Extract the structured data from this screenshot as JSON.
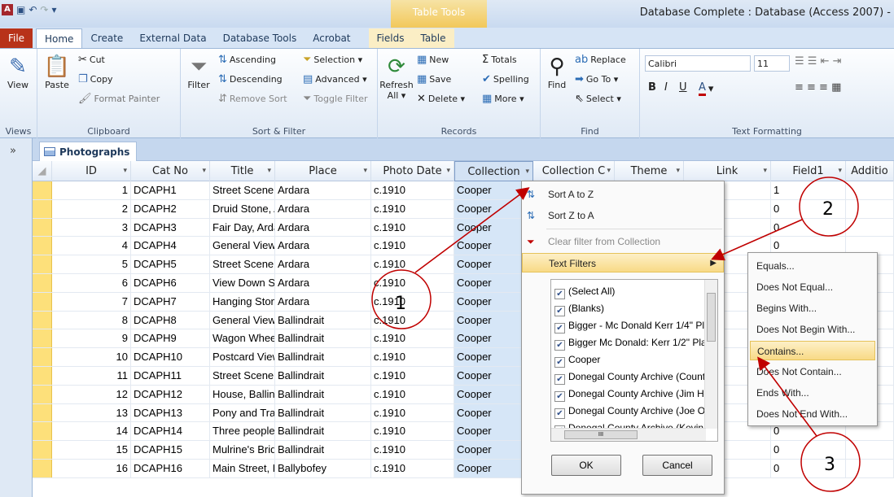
{
  "window": {
    "title": "Database Complete : Database (Access 2007) -",
    "context_tab": "Table Tools"
  },
  "tabs": [
    "File",
    "Home",
    "Create",
    "External Data",
    "Database Tools",
    "Acrobat",
    "Fields",
    "Table"
  ],
  "ribbon": {
    "views": {
      "view": "View",
      "label": "Views"
    },
    "clipboard": {
      "paste": "Paste",
      "cut": "Cut",
      "copy": "Copy",
      "format_painter": "Format Painter",
      "label": "Clipboard"
    },
    "sort_filter": {
      "filter": "Filter",
      "ascending": "Ascending",
      "descending": "Descending",
      "remove_sort": "Remove Sort",
      "selection": "Selection ▾",
      "advanced": "Advanced ▾",
      "toggle_filter": "Toggle Filter",
      "label": "Sort & Filter"
    },
    "records": {
      "refresh": "Refresh All ▾",
      "new": "New",
      "save": "Save",
      "delete": "Delete ▾",
      "totals": "Totals",
      "spelling": "Spelling",
      "more": "More ▾",
      "label": "Records"
    },
    "find": {
      "find": "Find",
      "replace": "Replace",
      "goto": "Go To ▾",
      "select": "Select ▾",
      "label": "Find"
    },
    "text_formatting": {
      "font": "Calibri",
      "size": "11",
      "label": "Text Formatting"
    }
  },
  "nav": {
    "toggle": "»"
  },
  "document_tab": "Photographs",
  "columns": [
    {
      "label": "ID"
    },
    {
      "label": "Cat No"
    },
    {
      "label": "Title"
    },
    {
      "label": "Place"
    },
    {
      "label": "Photo Date"
    },
    {
      "label": "Collection"
    },
    {
      "label": "Collection C"
    },
    {
      "label": "Theme"
    },
    {
      "label": "Link"
    },
    {
      "label": "Field1"
    },
    {
      "label": "Additio"
    }
  ],
  "rows": [
    {
      "id": "1",
      "cat": "DCAPH1",
      "title": "Street Scene, /",
      "place": "Ardara",
      "date": "c.1910",
      "coll": "Cooper",
      "field1": "1"
    },
    {
      "id": "2",
      "cat": "DCAPH2",
      "title": "Druid Stone, A",
      "place": "Ardara",
      "date": "c.1910",
      "coll": "Cooper",
      "field1": "0"
    },
    {
      "id": "3",
      "cat": "DCAPH3",
      "title": "Fair Day, Ardar",
      "place": "Ardara",
      "date": "c.1910",
      "coll": "Cooper",
      "field1": "0"
    },
    {
      "id": "4",
      "cat": "DCAPH4",
      "title": "General View,",
      "place": "Ardara",
      "date": "c.1910",
      "coll": "Cooper",
      "field1": "0"
    },
    {
      "id": "5",
      "cat": "DCAPH5",
      "title": "Street Scene, /",
      "place": "Ardara",
      "date": "c.1910",
      "coll": "Cooper",
      "field1": ""
    },
    {
      "id": "6",
      "cat": "DCAPH6",
      "title": "View Down Str",
      "place": "Ardara",
      "date": "c.1910",
      "coll": "Cooper",
      "field1": ""
    },
    {
      "id": "7",
      "cat": "DCAPH7",
      "title": "Hanging Stone",
      "place": "Ardara",
      "date": "c.1910",
      "coll": "Cooper",
      "field1": ""
    },
    {
      "id": "8",
      "cat": "DCAPH8",
      "title": "General View,",
      "place": "Ballindrait",
      "date": "c.1910",
      "coll": "Cooper",
      "field1": ""
    },
    {
      "id": "9",
      "cat": "DCAPH9",
      "title": "Wagon Wheel:",
      "place": "Ballindrait",
      "date": "c.1910",
      "coll": "Cooper",
      "field1": ""
    },
    {
      "id": "10",
      "cat": "DCAPH10",
      "title": "Postcard View",
      "place": "Ballindrait",
      "date": "c.1910",
      "coll": "Cooper",
      "field1": ""
    },
    {
      "id": "11",
      "cat": "DCAPH11",
      "title": "Street Scene, E",
      "place": "Ballindrait",
      "date": "c.1910",
      "coll": "Cooper",
      "field1": ""
    },
    {
      "id": "12",
      "cat": "DCAPH12",
      "title": "House, Ballind",
      "place": "Ballindrait",
      "date": "c.1910",
      "coll": "Cooper",
      "field1": ""
    },
    {
      "id": "13",
      "cat": "DCAPH13",
      "title": "Pony and Trap,",
      "place": "Ballindrait",
      "date": "c.1910",
      "coll": "Cooper",
      "field1": ""
    },
    {
      "id": "14",
      "cat": "DCAPH14",
      "title": "Three people :",
      "place": "Ballindrait",
      "date": "c.1910",
      "coll": "Cooper",
      "field1": "0"
    },
    {
      "id": "15",
      "cat": "DCAPH15",
      "title": "Mulrine's Bridg",
      "place": "Ballindrait",
      "date": "c.1910",
      "coll": "Cooper",
      "field1": "0"
    },
    {
      "id": "16",
      "cat": "DCAPH16",
      "title": "Main Street, B:",
      "place": "Ballybofey",
      "date": "c.1910",
      "coll": "Cooper",
      "field1": "0"
    }
  ],
  "filter_menu": {
    "sort_az": "Sort A to Z",
    "sort_za": "Sort Z to A",
    "clear_filter": "Clear filter from Collection",
    "text_filters": "Text Filters",
    "values": [
      "(Select All)",
      "(Blanks)",
      "Bigger - Mc Donald Kerr 1/4\" Pl",
      "Bigger Mc Donald: Kerr 1/2\" Pla",
      "Cooper",
      "Donegal County Archive (Count",
      "Donegal County Archive (Jim H",
      "Donegal County Archive (Joe O",
      "Donegal County Archive (Kevin"
    ],
    "ok": "OK",
    "cancel": "Cancel"
  },
  "text_filters_submenu": [
    "Equals...",
    "Does Not Equal...",
    "Begins With...",
    "Does Not Begin With...",
    "Contains...",
    "Does Not Contain...",
    "Ends With...",
    "Does Not End With..."
  ],
  "annotations": {
    "callout_1": "1",
    "callout_2": "2",
    "callout_3": "3",
    "color": "#c00000"
  }
}
